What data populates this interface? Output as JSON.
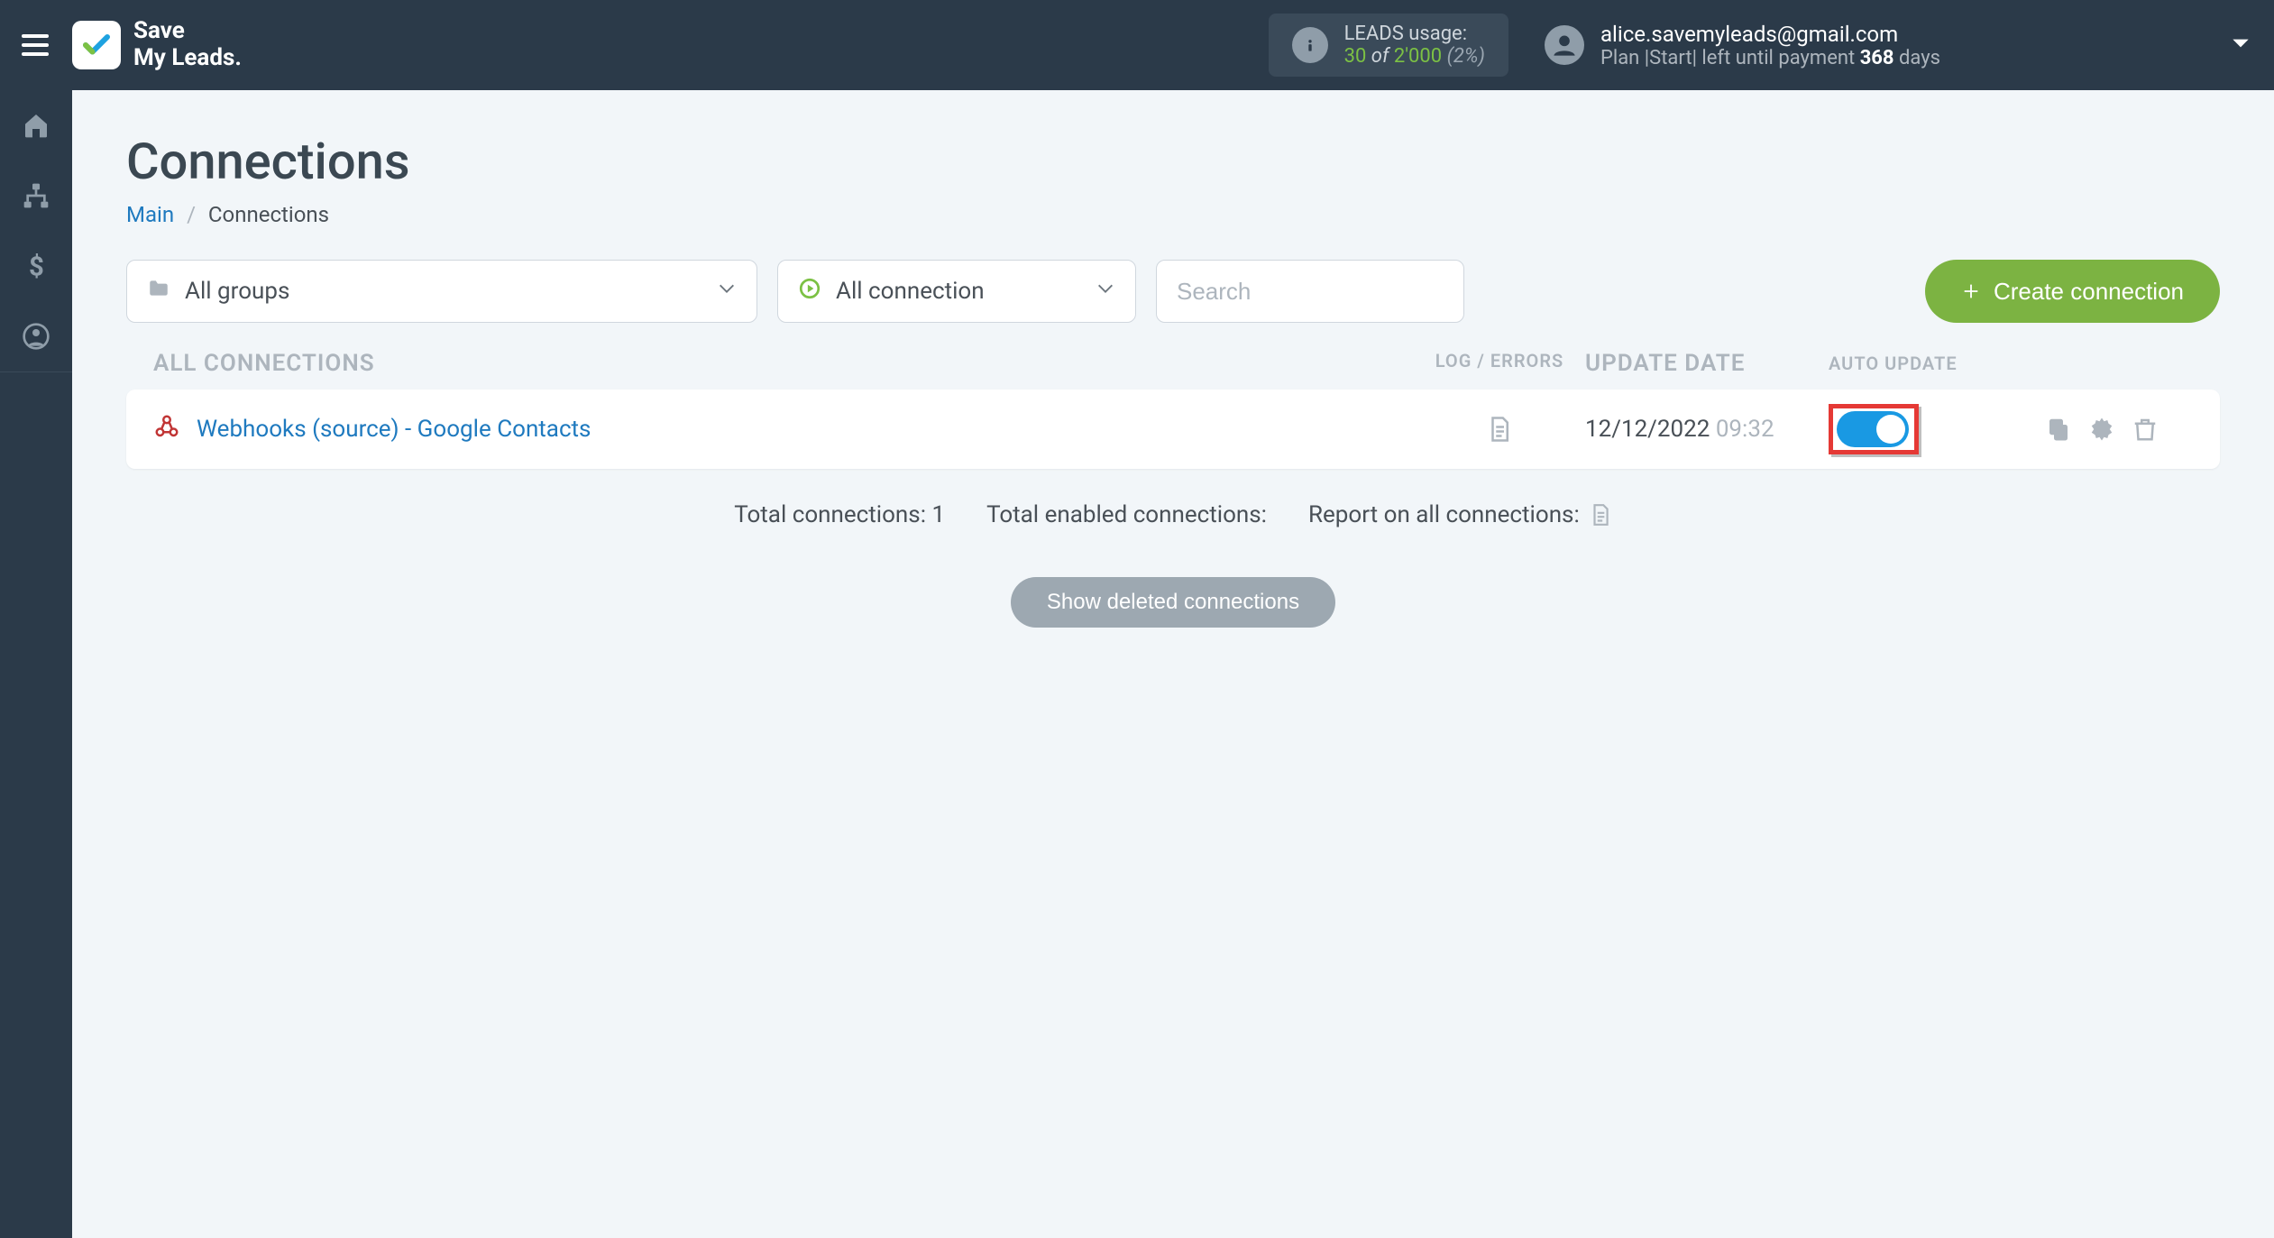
{
  "brand": {
    "line1": "Save",
    "line2": "My Leads."
  },
  "usage": {
    "label": "LEADS usage:",
    "used": "30",
    "of": "of",
    "total": "2'000",
    "pct": "(2%)"
  },
  "account": {
    "email": "alice.savemyleads@gmail.com",
    "plan_prefix": "Plan |Start| left until payment ",
    "days": "368",
    "days_suffix": " days"
  },
  "page": {
    "title": "Connections",
    "breadcrumb_main": "Main",
    "breadcrumb_current": "Connections"
  },
  "filters": {
    "groups": "All groups",
    "status": "All connection",
    "search_ph": "Search"
  },
  "create_label": "Create connection",
  "thead": {
    "c1": "ALL CONNECTIONS",
    "c2": "LOG / ERRORS",
    "c3": "UPDATE DATE",
    "c4": "AUTO UPDATE"
  },
  "row": {
    "name": "Webhooks (source) - Google Contacts",
    "date": "12/12/2022",
    "time": "09:32"
  },
  "summary": {
    "total": "Total connections: 1",
    "enabled": "Total enabled connections:",
    "report": "Report on all connections:"
  },
  "show_deleted": "Show deleted connections"
}
